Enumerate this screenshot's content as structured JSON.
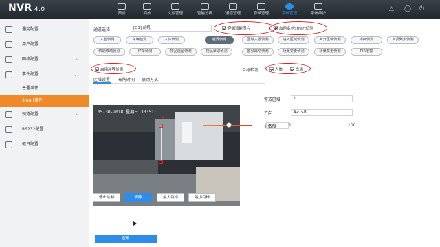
{
  "app": {
    "title": "NVR",
    "version": "4.0"
  },
  "topnav": [
    {
      "label": "预览",
      "icon": "preview-icon",
      "active": false
    },
    {
      "label": "回放",
      "icon": "playback-icon",
      "active": false
    },
    {
      "label": "文件管理",
      "icon": "folder-icon",
      "active": false
    },
    {
      "label": "智能分析",
      "icon": "analysis-icon",
      "active": false
    },
    {
      "label": "通道管理",
      "icon": "channel-icon",
      "active": false
    },
    {
      "label": "存储管理",
      "icon": "storage-icon",
      "active": false
    },
    {
      "label": "系统管理",
      "icon": "gear-icon",
      "active": true
    },
    {
      "label": "系统维护",
      "icon": "wrench-icon",
      "active": false
    }
  ],
  "topright": {
    "alert": "△",
    "user": "◯",
    "power": "⏻"
  },
  "sidebar": {
    "items": [
      {
        "label": "通用配置",
        "icon": "gear-icon"
      },
      {
        "label": "用户配置",
        "icon": "user-icon"
      },
      {
        "label": "网络配置",
        "icon": "network-icon",
        "chevron": "›"
      },
      {
        "label": "事件配置",
        "icon": "event-icon",
        "chevron": "⌄"
      }
    ],
    "sub": [
      "普通事件",
      "Smart事件"
    ],
    "items2": [
      {
        "label": "预览配置",
        "icon": "preview-icon",
        "chevron": "›"
      },
      {
        "label": "RS232配置",
        "icon": "serial-icon"
      },
      {
        "label": "假日配置",
        "icon": "calendar-icon"
      }
    ]
  },
  "main": {
    "channel_label": "通道选择",
    "channel_value": "[D1] 前机",
    "save_smart_pic": "存储智能图片",
    "enable_local_smart": "启用本地Smart侦测",
    "events_row1": [
      "人脸侦测",
      "车辆检测",
      "人体侦测",
      "越界侦测",
      "区域入侵侦测",
      "进入区域侦测",
      "离开区域侦测",
      "徘徊侦测",
      "人员聚集侦测"
    ],
    "events_row2": [
      "快速移动侦测",
      "停车侦测",
      "物品遗留侦测",
      "物品拿取侦测",
      "音频异常侦测",
      "场景变更侦测",
      "场景变更侦测",
      "PIR报警"
    ],
    "enable_line_cross": "启用越界侦测",
    "target_label": "目标检测",
    "target_human": "人体",
    "target_vehicle": "车辆",
    "tabs": [
      "区域设置",
      "布防时间",
      "联动方式"
    ],
    "video_timestamp": "05-30-2018 星期三 13:51:",
    "video_cam": "前机",
    "det_label": "0",
    "warning_zone_label": "警戒区域",
    "warning_zone_value": "1",
    "direction_label": "方向",
    "direction_value": "A<->B",
    "sensitivity_label": "灵敏度",
    "sensitivity_min": "1",
    "sensitivity_max": "100",
    "sensitivity_value": "52",
    "btn_stop": "停止绘制",
    "btn_clear": "清除",
    "btn_max": "最大目标",
    "btn_min": "最小目标",
    "apply": "应用"
  },
  "colors": {
    "accent": "#2e8de8",
    "sidebar_active": "#f08a28",
    "annotation": "#d61e1e"
  }
}
